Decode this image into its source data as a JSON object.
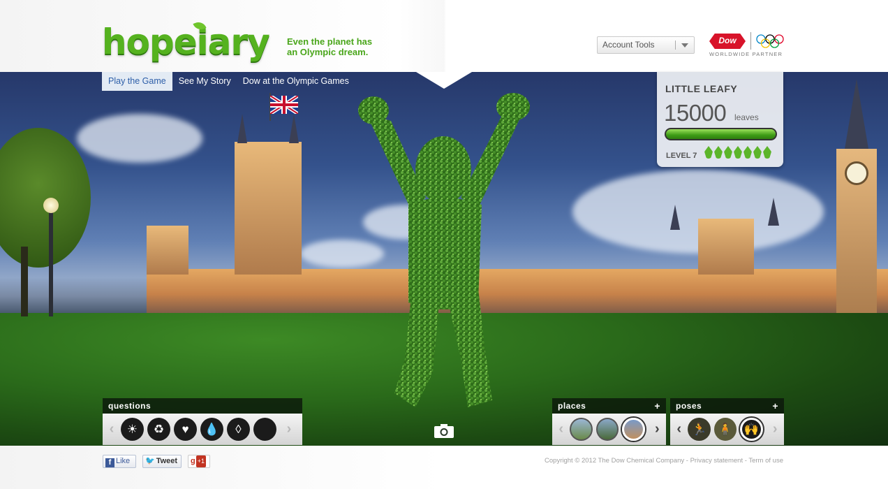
{
  "header": {
    "logo_text": "hopeiary",
    "tagline_line1": "Even the planet has",
    "tagline_line2": "an Olympic dream.",
    "account_tools": "Account Tools",
    "partner_brand": "Dow",
    "partner_text": "WORLDWIDE PARTNER"
  },
  "nav": {
    "items": [
      {
        "label": "Play the Game",
        "active": true
      },
      {
        "label": "See My Story",
        "active": false
      },
      {
        "label": "Dow at the Olympic Games",
        "active": false
      }
    ]
  },
  "score": {
    "player_name": "LITTLE LEAFY",
    "leaves": "15000",
    "leaves_unit": "leaves",
    "progress_fraction": 1.0,
    "level_label": "LEVEL 7",
    "level_leaf_count": 7
  },
  "questions_panel": {
    "title": "questions",
    "icons": [
      "sun-icon",
      "recycle-icon",
      "heart-icon",
      "water-drop-icon",
      "water-drop-outline-icon",
      "leaf-icon"
    ]
  },
  "places_panel": {
    "title": "places",
    "plus": "+",
    "icons": [
      "stonehenge-place-icon",
      "city-place-icon",
      "parliament-place-icon"
    ]
  },
  "poses_panel": {
    "title": "poses",
    "plus": "+",
    "icons": [
      "running-pose-icon",
      "standing-pose-icon",
      "jumping-pose-icon"
    ]
  },
  "footer": {
    "like": "Like",
    "tweet": "Tweet",
    "gplus_g": "g",
    "gplus": "+1",
    "copyright": "Copyright © 2012 The Dow Chemical Company",
    "sep": " - ",
    "privacy": "Privacy statement",
    "terms": "Term of use"
  },
  "colors": {
    "brand_green": "#55b21f",
    "nav_active_bg": "#e3ebf4",
    "nav_active_text": "#2c5ea8",
    "dow_red": "#d8132a"
  }
}
